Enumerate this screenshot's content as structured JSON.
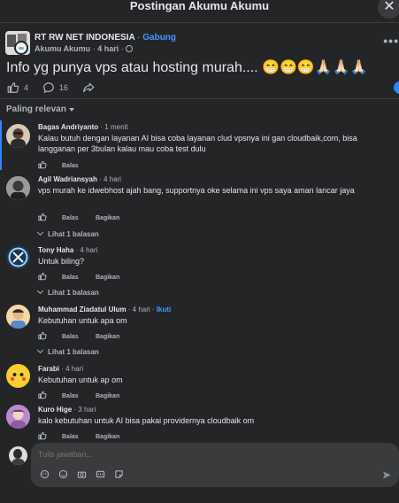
{
  "header": {
    "title": "Postingan Akumu Akumu",
    "close_icon": "close-icon"
  },
  "post": {
    "group_name": "RT RW NET INDONESIA",
    "separator": "·",
    "join_label": "Gabung",
    "author": "Akumu Akumu",
    "time": "4 hari",
    "more_label": "•••",
    "text": "Info yg punya vps atau hosting murah.... 😁😁😁🙏🏻🙏🏻🙏🏻",
    "likes": "4",
    "comments": "16"
  },
  "sort": {
    "label": "Paling relevan"
  },
  "comments": [
    {
      "name": "Bagas Andriyanto",
      "time": "· 1 menit",
      "text": "Kalau butuh dengan layanan AI bisa coba layanan clud vpsnya ini gan cloudbaik,com, bisa langganan per 3bulan kalau mau coba test dulu",
      "reply_label": "Balas"
    },
    {
      "name": "Agil Wadriansyah",
      "time": "· 4 hari",
      "text": "vps murah ke idwebhost ajah bang, supportnya oke selama ini vps saya aman lancar jaya",
      "reply_label": "Balas",
      "share_label": "Bagikan",
      "replies_label": "Lihat 1 balasan"
    },
    {
      "name": "Tony Haha",
      "time": "· 4 hari",
      "text": "Untuk biling?",
      "reply_label": "Balas",
      "share_label": "Bagikan",
      "replies_label": "Lihat 1 balasan"
    },
    {
      "name": "Muhammad Ziadatul Ulum",
      "time": "· 4 hari ·",
      "follow_label": "Ikuti",
      "text": "Kebutuhan untuk apa om",
      "reply_label": "Balas",
      "share_label": "Bagikan",
      "replies_label": "Lihat 1 balasan"
    },
    {
      "name": "Farabi",
      "time": "· 4 hari",
      "text": "Kebutuhan untuk ap om",
      "reply_label": "Balas",
      "share_label": "Bagikan"
    },
    {
      "name": "Kuro Hige",
      "time": "· 3 hari",
      "text": "kalo kebutuhan untuk AI bisa pakai providernya cloudbaik om",
      "reply_label": "Balas",
      "share_label": "Bagikan"
    }
  ],
  "reply": {
    "placeholder": "Tulis jawaban..."
  },
  "colors": {
    "background": "#242526",
    "accent": "#4599ff",
    "text": "#e4e6eb",
    "muted": "#b0b3b8"
  }
}
